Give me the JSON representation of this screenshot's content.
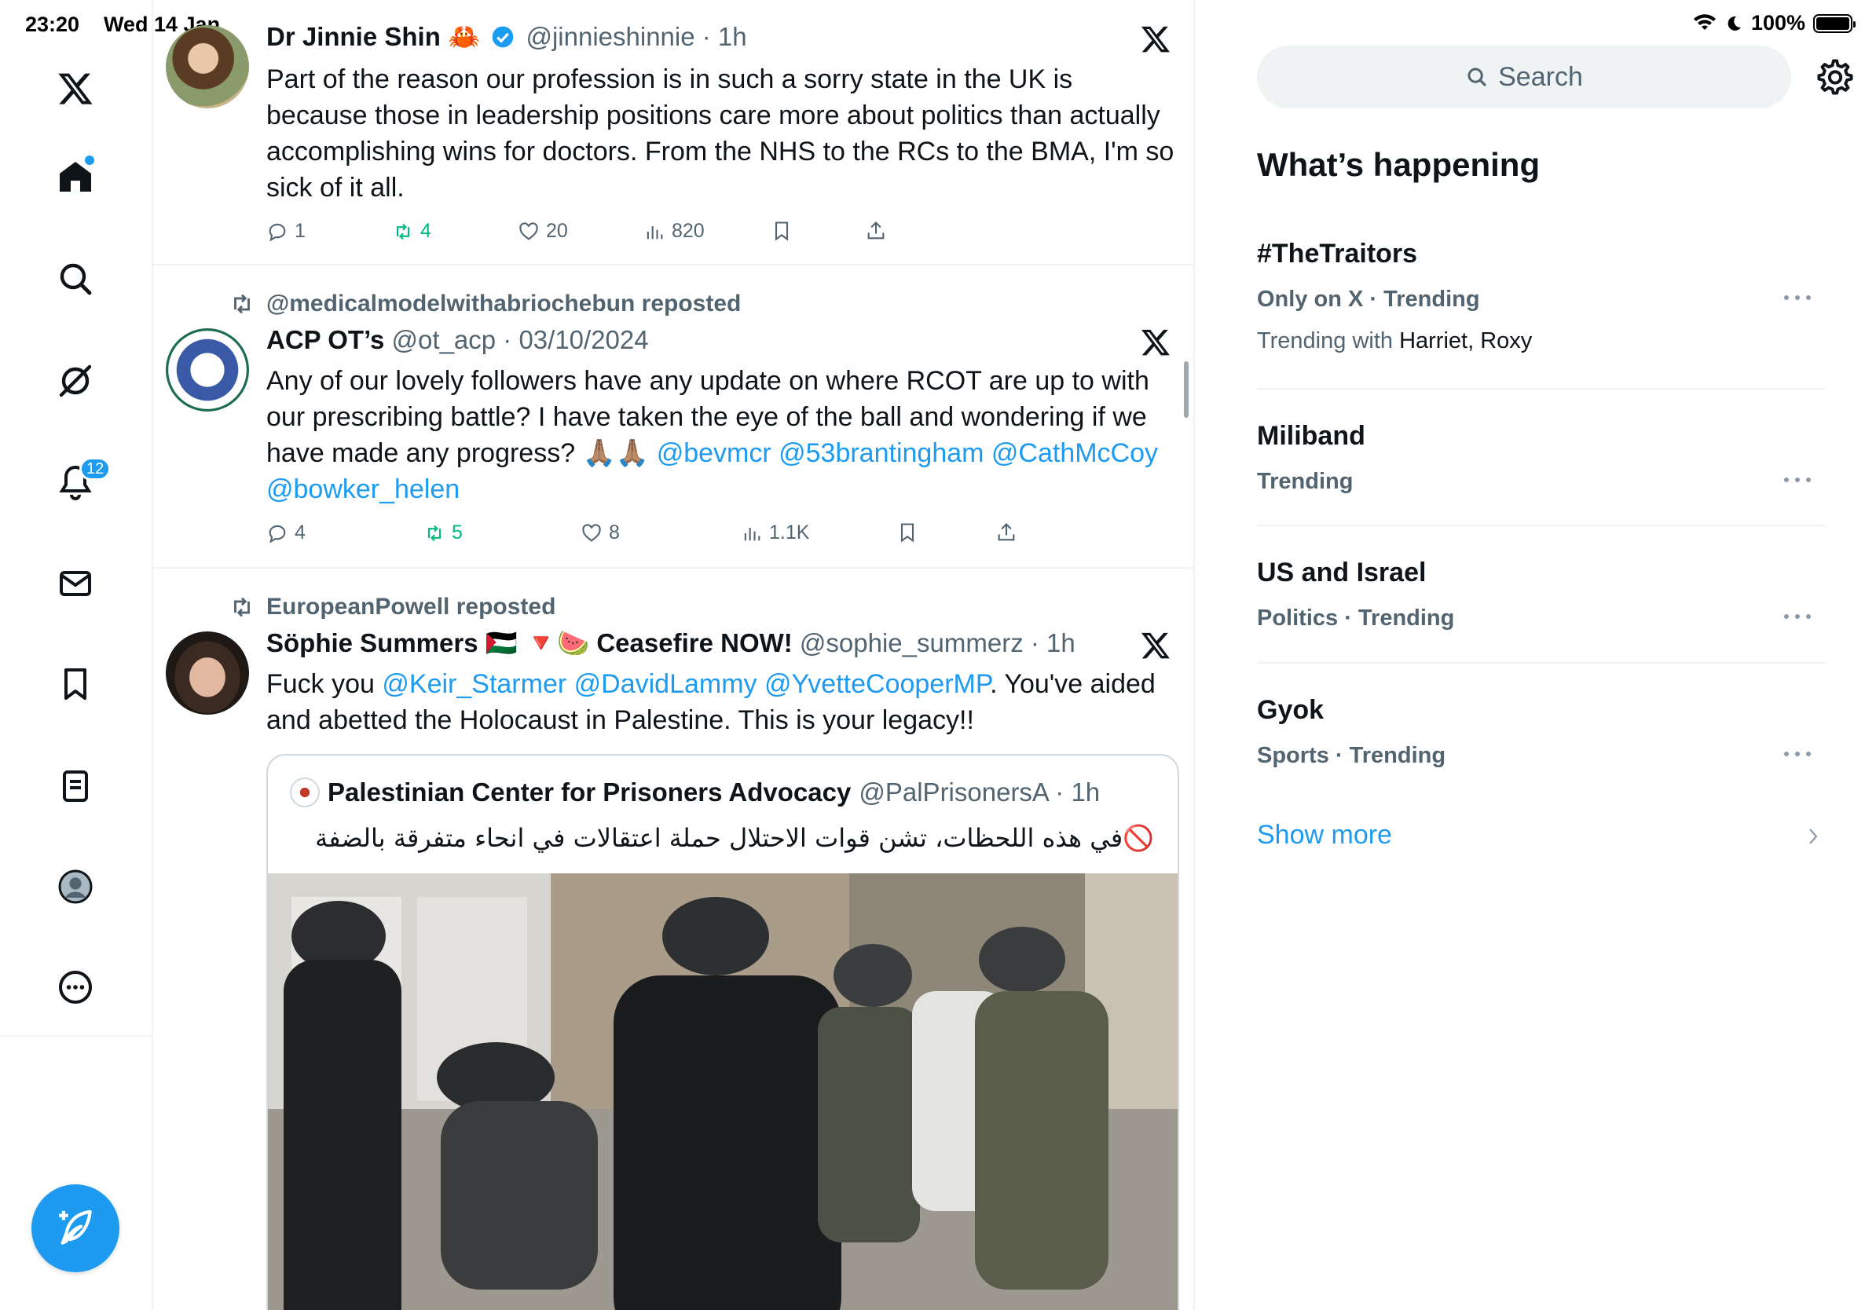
{
  "status_bar": {
    "time": "23:20",
    "date": "Wed 14 Jan",
    "battery": "100%"
  },
  "nav": {
    "notifications_badge": "12",
    "items": [
      "home-icon",
      "explore-icon",
      "grok-icon",
      "notifications-icon",
      "messages-icon",
      "bookmarks-icon",
      "lists-icon",
      "profile-icon",
      "more-icon"
    ]
  },
  "tweets": [
    {
      "name": "Dr Jinnie Shin 🦀",
      "handle": "@jinnieshinnie · 1h",
      "lines": [
        "Part of the reason our profession is in such a sorry state in the UK is",
        "because those in leadership positions care more about politics than actually",
        "accomplishing wins for doctors. From the NHS to the RCs to the BMA, I'm so",
        "sick of it all."
      ],
      "replies": "1",
      "reposts": "4",
      "likes": "20",
      "views": "820"
    },
    {
      "reposted_by": "@medicalmodelwithabriochebun reposted",
      "name": "ACP OT’s",
      "handle": "@ot_acp · 03/10/2024",
      "lines": [
        "Any of our lovely followers have any update on where RCOT are up to with",
        "our prescribing battle? I have taken the eye of the ball and wondering if we"
      ],
      "line3_text": "have made any progress? 🙏🏽🙏🏽 ",
      "line3_mentions": "@bevmcr @53brantingham @CathMcCoy",
      "line4_mention": "@bowker_helen",
      "replies": "4",
      "reposts": "5",
      "likes": "8",
      "views": "1.1K"
    },
    {
      "reposted_by": "EuropeanPowell reposted",
      "name": "Söphie Summers 🇵🇸 🔻🍉 Ceasefire NOW!",
      "handle": "@sophie_summerz · 1h",
      "line1_start": "Fuck you ",
      "line1_mentions": "@Keir_Starmer @DavidLammy @YvetteCooperMP",
      "line1_end": ". You've aided",
      "line2": "and abetted the Holocaust in Palestine. This is your legacy!!",
      "quote": {
        "name": "Palestinian Center for Prisoners Advocacy",
        "handle": "@PalPrisonersA · 1h",
        "text": "🚫في هذه اللحظات، تشن قوات الاحتلال حملة اعتقالات في انحاء متفرقة بالضفة"
      }
    }
  ],
  "search": {
    "placeholder": "Search"
  },
  "trends_title": "What’s happening",
  "trends": [
    {
      "title": "#TheTraitors",
      "meta": "Only on X · Trending",
      "with_label": "Trending with ",
      "with_names": "Harriet, Roxy"
    },
    {
      "title": "Miliband",
      "meta": "Trending"
    },
    {
      "title": "US and Israel",
      "meta": "Politics · Trending"
    },
    {
      "title": "Gyok",
      "meta": "Sports · Trending"
    }
  ],
  "show_more": "Show more",
  "colors": {
    "accent": "#1d9bf0",
    "repost_green": "#00ba7c",
    "muted": "#536471",
    "divider": "#eff3f4"
  }
}
